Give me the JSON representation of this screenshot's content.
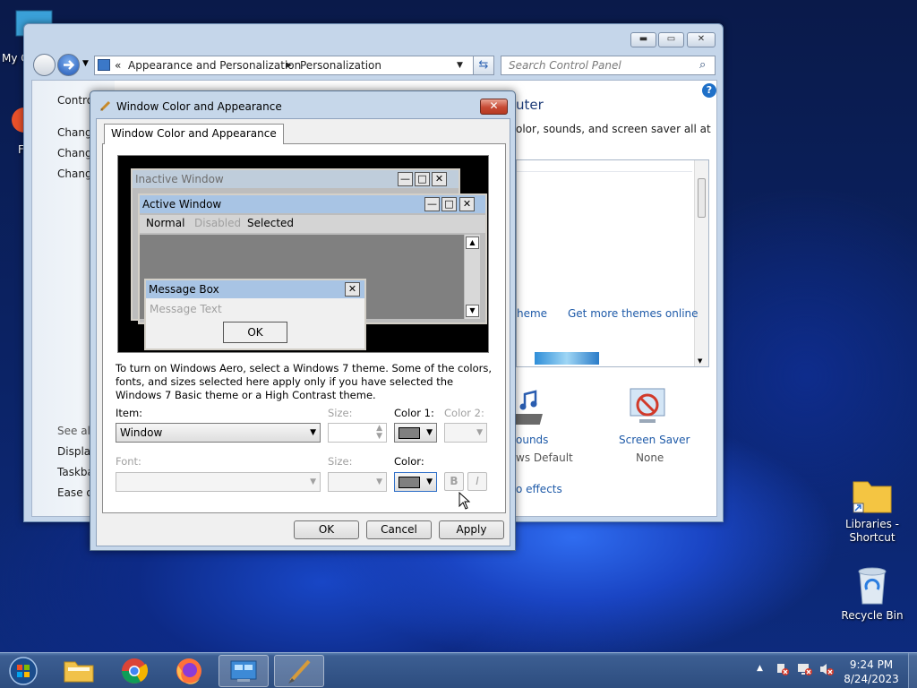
{
  "desktop": {
    "icons": [
      {
        "label": "My C",
        "icon": "computer-icon"
      },
      {
        "label": "F",
        "icon": "file-icon"
      },
      {
        "label": "Libraries - Shortcut",
        "icon": "folder-shortcut-icon"
      },
      {
        "label": "Recycle Bin",
        "icon": "recycle-bin-icon"
      }
    ]
  },
  "control_panel": {
    "breadcrumb_root": "«",
    "breadcrumb": [
      "Appearance and Personalization",
      "Personalization"
    ],
    "search_placeholder": "Search Control Panel",
    "left_links": [
      "Control",
      "Change",
      "Change",
      "Change"
    ],
    "see_also": {
      "header": "See also",
      "links": [
        "Display",
        "Taskba",
        "Ease of"
      ]
    },
    "heading_fragment": "uter",
    "intro_fragment": "olor, sounds, and screen saver all at",
    "theme_links": [
      "heme",
      "Get more themes online"
    ],
    "sounds": {
      "label": "ounds",
      "value": "ws Default"
    },
    "screen_saver": {
      "label": "Screen Saver",
      "value": "None"
    },
    "effects_link": "o effects"
  },
  "dialog": {
    "title": "Window Color and Appearance",
    "tab": "Window Color and Appearance",
    "preview": {
      "inactive_title": "Inactive Window",
      "active_title": "Active Window",
      "menu": [
        "Normal",
        "Disabled",
        "Selected"
      ],
      "message_box_title": "Message Box",
      "message_text": "Message Text",
      "ok": "OK"
    },
    "description": "To turn on Windows Aero, select a Windows 7 theme.  Some of the colors, fonts, and sizes selected here apply only if you have selected the Windows 7 Basic theme or a High Contrast theme.",
    "item_label": "Item:",
    "item_value": "Window",
    "size_label": "Size:",
    "color1_label": "Color 1:",
    "color2_label": "Color 2:",
    "font_label": "Font:",
    "font_size_label": "Size:",
    "color_label": "Color:",
    "bold": "B",
    "italic": "I",
    "buttons": {
      "ok": "OK",
      "cancel": "Cancel",
      "apply": "Apply"
    },
    "swatch_color": "#808080"
  },
  "taskbar": {
    "items": [
      "start-orb-icon",
      "file-explorer-icon",
      "chrome-icon",
      "firefox-icon",
      "control-panel-icon",
      "paint-brush-icon"
    ],
    "time": "9:24 PM",
    "date": "8/24/2023"
  },
  "colors": {
    "accent": "#1e5aa8",
    "close": "#c74a34",
    "title_bar": "#c6d7ea"
  }
}
